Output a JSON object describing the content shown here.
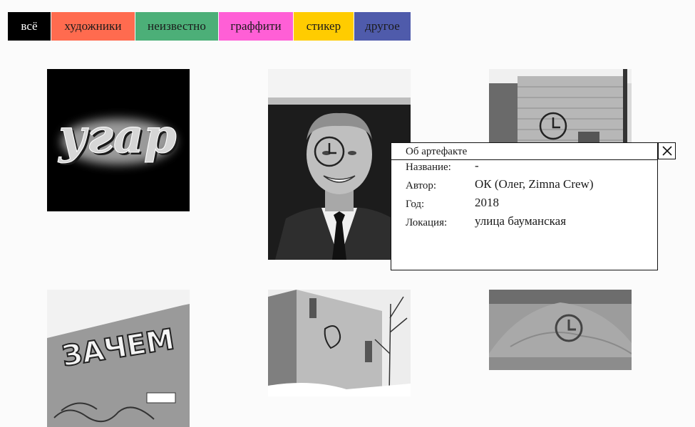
{
  "filters": [
    {
      "label": "всё",
      "color": "#000000",
      "active": true
    },
    {
      "label": "художники",
      "color": "#ff6b4f"
    },
    {
      "label": "неизвестно",
      "color": "#4caf78"
    },
    {
      "label": "граффити",
      "color": "#ff5fd6"
    },
    {
      "label": "стикер",
      "color": "#ffcc00"
    },
    {
      "label": "другое",
      "color": "#4f5bab"
    }
  ],
  "tiles": {
    "ugar_text": "угар",
    "zachem_text": "ЗАЧЕМ"
  },
  "modal": {
    "title": "Об артефакте",
    "fields": [
      {
        "label": "Название:",
        "value": "-"
      },
      {
        "label": "Автор:",
        "value": "ОК (Олег, Zimna Crew)"
      },
      {
        "label": "Год:",
        "value": "2018"
      },
      {
        "label": "Локация:",
        "value": "улица бауманская"
      }
    ]
  }
}
